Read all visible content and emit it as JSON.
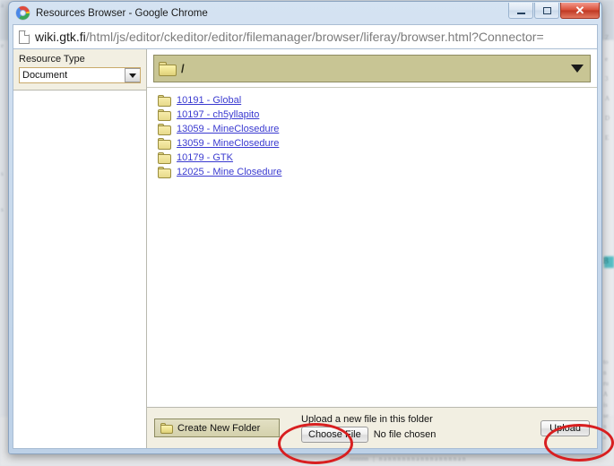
{
  "window": {
    "title": "Resources Browser - Google Chrome",
    "logo_icon": "chrome-logo-icon",
    "controls": {
      "minimize": "minimize-icon",
      "maximize": "maximize-icon",
      "close": "✕"
    }
  },
  "omnibox": {
    "page_icon": "document-icon",
    "url_host": "wiki.gtk.fi",
    "url_path": "/html/js/editor/ckeditor/editor/filemanager/browser/liferay/browser.html?Connector=",
    "url_full": "wiki.gtk.fi/html/js/editor/ckeditor/editor/filemanager/browser/liferay/browser.html?Connector="
  },
  "sidebar": {
    "resource_type_label": "Resource Type",
    "resource_type_value": "Document",
    "resource_type_arrow_icon": "chevron-down-icon"
  },
  "path_bar": {
    "folder_icon": "folder-icon",
    "path": "/",
    "dropdown_icon": "caret-down-icon"
  },
  "folders": [
    {
      "icon": "folder-icon",
      "name": "10191 - Global"
    },
    {
      "icon": "folder-icon",
      "name": "10197 - ch5yllapito"
    },
    {
      "icon": "folder-icon",
      "name": "13059 - MineClosedure"
    },
    {
      "icon": "folder-icon",
      "name": "13059 - MineClosedure"
    },
    {
      "icon": "folder-icon",
      "name": "10179 - GTK"
    },
    {
      "icon": "folder-icon",
      "name": "12025 - Mine Closedure"
    }
  ],
  "toolbar": {
    "create_folder_icon": "folder-icon",
    "create_folder_label": "Create New Folder",
    "upload_hint": "Upload a new file in this folder",
    "choose_file_label": "Choose File",
    "no_file_label": "No file chosen",
    "upload_label": "Upload"
  },
  "annotations": {
    "accent_color": "#d81f20",
    "marks": [
      {
        "name": "choose-file-highlight"
      },
      {
        "name": "upload-highlight"
      }
    ]
  },
  "background": {
    "lines": [
      "a",
      "e",
      "s",
      "s",
      "Z",
      "e",
      "3",
      "A",
      "D",
      "E",
      "B",
      "to",
      "n",
      "ru",
      "A",
      "is",
      "se",
      "n",
      "5",
      "a",
      "u",
      "n",
      "a"
    ]
  }
}
